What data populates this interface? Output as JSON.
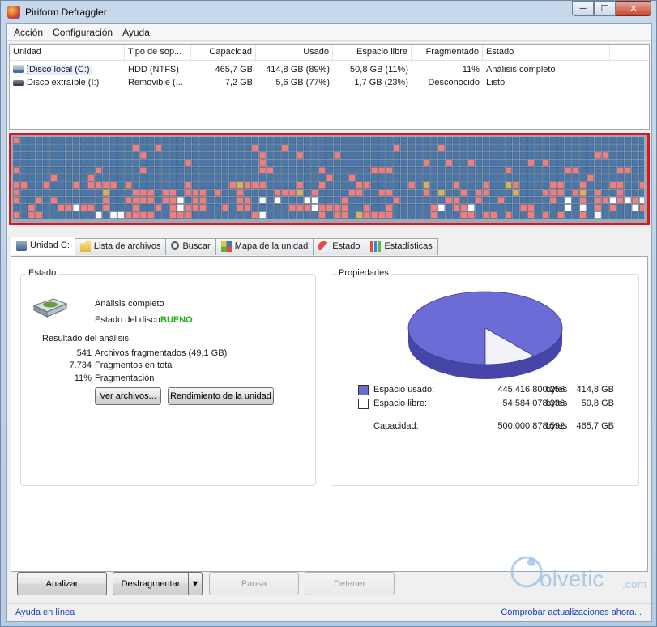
{
  "window": {
    "title": "Piriform Defraggler",
    "controls": [
      "─",
      "☐",
      "✕"
    ]
  },
  "menu": [
    "Acción",
    "Configuración",
    "Ayuda"
  ],
  "drives": {
    "columns": [
      "Unidad",
      "Tipo de sop...",
      "Capacidad",
      "Usado",
      "Espacio libre",
      "Fragmentado",
      "Estado"
    ],
    "rows": [
      {
        "icon": "hard-disk-icon",
        "unit": "Disco local (C:)",
        "type": "HDD (NTFS)",
        "capacity": "465,7 GB",
        "used": "414,8 GB (89%)",
        "free": "50,8 GB (11%)",
        "fragmented": "11%",
        "status": "Análisis completo"
      },
      {
        "icon": "usb-drive-icon",
        "unit": "Disco extraíble (I:)",
        "type": "Removible (...",
        "capacity": "7,2 GB",
        "used": "5,6 GB (77%)",
        "free": "1,7 GB (23%)",
        "fragmented": "Desconocido",
        "status": "Listo"
      }
    ]
  },
  "drive_map": {
    "colors": {
      "used": "#4a76a8",
      "fragmented": "#ef7f7f",
      "free": "#ffffff",
      "system": "#d9b15a",
      "highlight_border": "#e2131a"
    }
  },
  "tabs": [
    "Unidad C:",
    "Lista de archivos",
    "Buscar",
    "Mapa de la unidad",
    "Estado",
    "Estadísticas"
  ],
  "estado": {
    "title": "Estado",
    "analysis": "Análisis completo",
    "disk_state_label": "Estado del disco:",
    "disk_state_value": "BUENO",
    "results_title": "Resultado del análisis:",
    "results": [
      {
        "value": "541",
        "label": "Archivos fragmentados (49,1 GB)"
      },
      {
        "value": "7.734",
        "label": "Fragmentos en total"
      },
      {
        "value": "11%",
        "label": "Fragmentación"
      }
    ],
    "view_files_button": "Ver archivos...",
    "performance_button": "Rendimiento de la unidad"
  },
  "propiedades": {
    "title": "Propiedades",
    "used_fraction": 0.89,
    "colors": {
      "used": "#6c6cd6",
      "free": "#f2f2f8"
    },
    "rows": [
      {
        "label": "Espacio usado:",
        "bytes": "445.416.800.256",
        "unit": "bytes",
        "size": "414,8 GB"
      },
      {
        "label": "Espacio libre:",
        "bytes": "54.584.078.336",
        "unit": "bytes",
        "size": "50,8 GB"
      },
      {
        "label": "Capacidad:",
        "bytes": "500.000.878.592",
        "unit": "bytes",
        "size": "465,7 GB"
      }
    ]
  },
  "actions": {
    "analyze": "Analizar",
    "defrag": "Desfragmentar",
    "pause": "Pausa",
    "stop": "Detener"
  },
  "footer": {
    "help_link": "Ayuda en línea",
    "update_link": "Comprobar actualizaciones ahora..."
  },
  "watermark": {
    "brand": "olvetic",
    "suffix": ".com"
  }
}
